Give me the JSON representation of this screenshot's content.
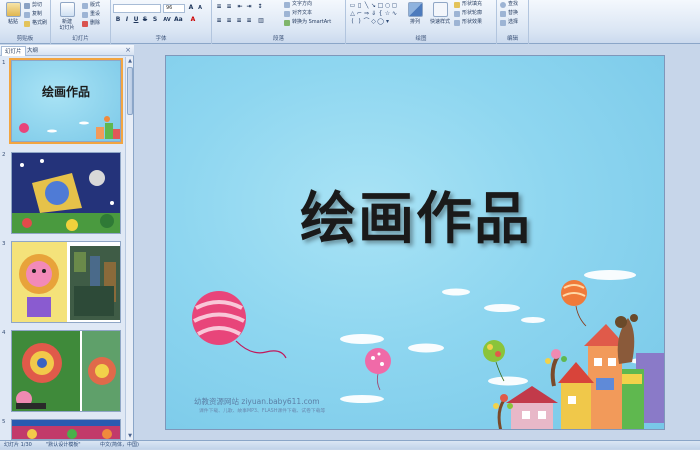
{
  "ribbon": {
    "clipboard": {
      "label": "剪贴板",
      "paste": "粘贴",
      "cut": "剪切",
      "copy": "复制",
      "format_painter": "格式刷"
    },
    "slides": {
      "label": "幻灯片",
      "new_slide": "新建\n幻灯片",
      "layout": "版式",
      "reset": "重设",
      "delete": "删除"
    },
    "font": {
      "label": "字体",
      "size": "96"
    },
    "paragraph": {
      "label": "段落",
      "text_direction": "文字方向",
      "align_text": "对齐文本",
      "smartart": "转换为 SmartArt"
    },
    "drawing": {
      "label": "绘图",
      "arrange": "排列",
      "quick_styles": "快速样式",
      "shape_fill": "形状填充",
      "shape_outline": "形状轮廓",
      "shape_effects": "形状效果"
    },
    "editing": {
      "label": "编辑",
      "find": "查找",
      "replace": "替换",
      "select": "选择"
    }
  },
  "panel": {
    "tab_slides": "幻灯片",
    "tab_outline": "大纲",
    "close": "×",
    "thumbs": [
      {
        "num": "1",
        "title": "绘画作品"
      },
      {
        "num": "2"
      },
      {
        "num": "3"
      },
      {
        "num": "4"
      },
      {
        "num": "5"
      }
    ]
  },
  "slide": {
    "title": "绘画作品",
    "watermark_main": "幼教资源网站  ziyuan.baby611.com",
    "watermark_sub": "课件下载、儿歌、故事MP3、FLASH课件下载、试卷下载等"
  },
  "status": {
    "slide_info": "幻灯片 1/30",
    "theme": "\"默认设计模板\"",
    "language": "中文(简体，中国)"
  },
  "colors": {
    "selected_outline": "#f2a541",
    "ribbon_blue": "#dbe6f4",
    "sky": "#8ed6f0"
  }
}
